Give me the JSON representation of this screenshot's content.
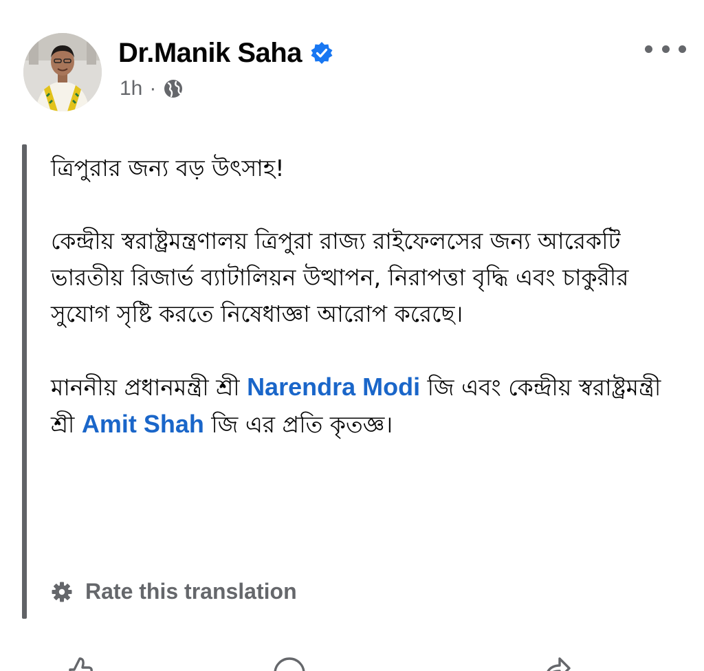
{
  "post": {
    "author_name": "Dr.Manik Saha",
    "time": "1h",
    "separator": "·",
    "paragraphs": {
      "p1": "ত্রিপুরার জন্য বড় উৎসাহ!",
      "p2": "কেন্দ্রীয় স্বরাষ্ট্রমন্ত্রণালয় ত্রিপুরা রাজ্য রাইফেলসের জন্য আরেকটি ভারতীয় রিজার্ভ ব্যাটালিয়ন উত্থাপন, নিরাপত্তা বৃদ্ধি এবং চাকুরীর সুযোগ সৃষ্টি করতে নিষেধাজ্ঞা আরোপ করেছে।",
      "p3_before": "মাননীয় প্রধানমন্ত্রী শ্রী",
      "mention1": "Narendra Modi",
      "p3_middle": "জি এবং কেন্দ্রীয় স্বরাষ্ট্রমন্ত্রী শ্রী",
      "mention2": "Amit Shah",
      "p3_after": "জি এর প্রতি কৃতজ্ঞ।"
    },
    "rate_translation": "Rate this translation"
  },
  "icons": {
    "verified": "verified-badge-icon",
    "privacy": "globe-icon",
    "more": "more-options-icon",
    "rate": "gear-icon",
    "like": "thumbs-up-icon",
    "comment": "comment-bubble-icon",
    "share": "share-arrow-icon"
  },
  "colors": {
    "link": "#1a66c9",
    "verified": "#1877f2",
    "secondary_text": "#65676b",
    "quote_bar": "#606266"
  }
}
